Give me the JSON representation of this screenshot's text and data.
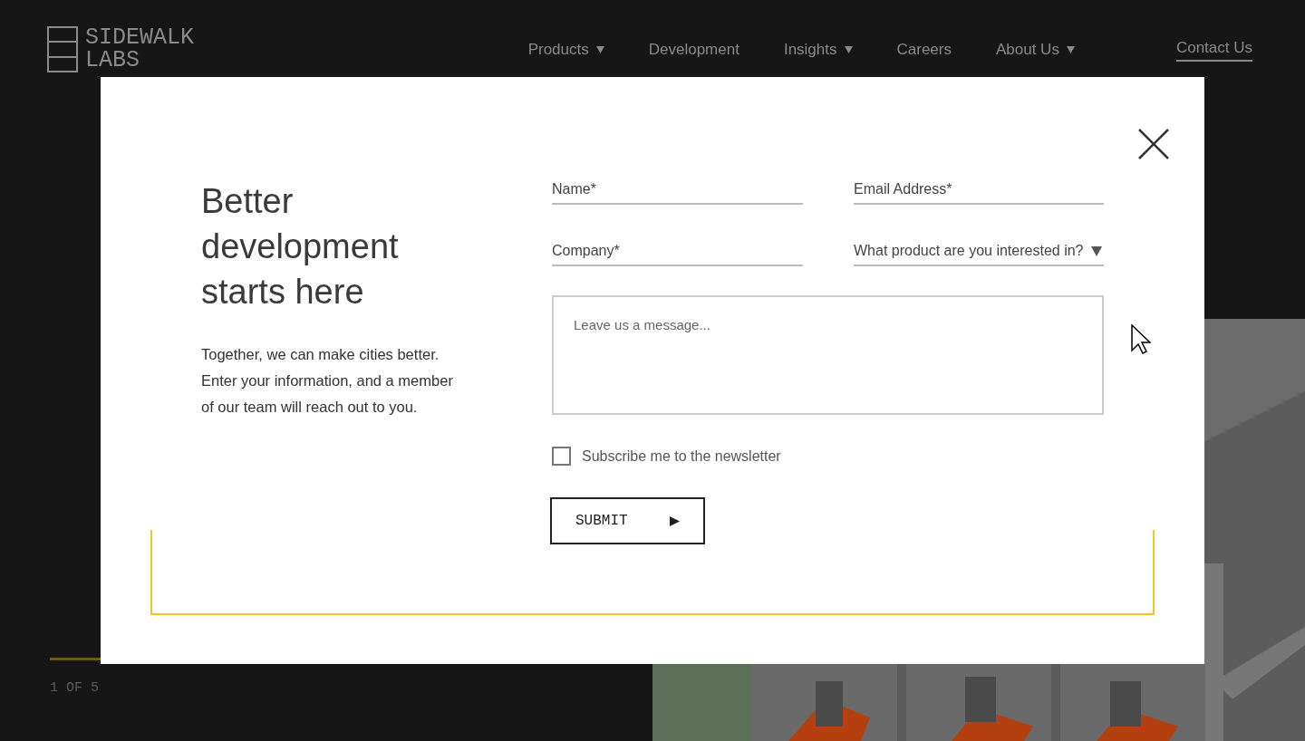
{
  "logo": {
    "lines": [
      "SIDEWALK",
      "LABS"
    ]
  },
  "nav": [
    {
      "label": "Products",
      "has_menu": true
    },
    {
      "label": "Development",
      "has_menu": false
    },
    {
      "label": "Insights",
      "has_menu": true
    },
    {
      "label": "Careers",
      "has_menu": false
    },
    {
      "label": "About Us",
      "has_menu": true
    }
  ],
  "contact_link": "Contact Us",
  "slide_counter": "1 OF 5",
  "modal": {
    "heading": "Better development starts here",
    "body": "Together, we can make cities better. Enter your information, and a member of our team will reach out to you.",
    "fields": [
      {
        "kind": "text",
        "placeholder": "Name*"
      },
      {
        "kind": "text",
        "placeholder": "Email Address*"
      },
      {
        "kind": "text",
        "placeholder": "Company*"
      },
      {
        "kind": "select",
        "placeholder": "What product are you interested in?"
      }
    ],
    "message": {
      "placeholder": "Leave us a message..."
    },
    "newsletter": {
      "label": "Subscribe me to the newsletter",
      "checked": false
    },
    "submit": "SUBMIT"
  }
}
